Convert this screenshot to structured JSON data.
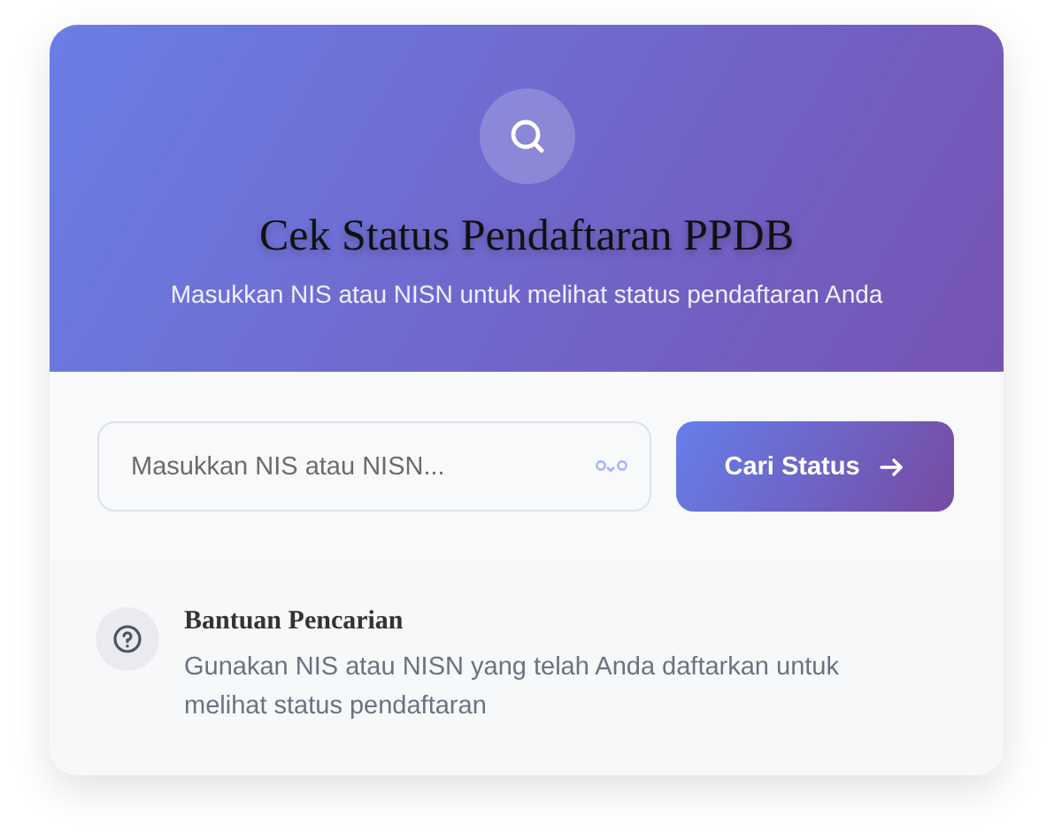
{
  "header": {
    "title": "Cek Status Pendaftaran PPDB",
    "subtitle": "Masukkan NIS atau NISN untuk melihat status pendaftaran Anda"
  },
  "search": {
    "placeholder": "Masukkan NIS atau NISN...",
    "button": "Cari Status"
  },
  "help": {
    "title": "Bantuan Pencarian",
    "text": "Gunakan NIS atau NISN yang telah Anda daftarkan untuk melihat status pendaftaran"
  }
}
